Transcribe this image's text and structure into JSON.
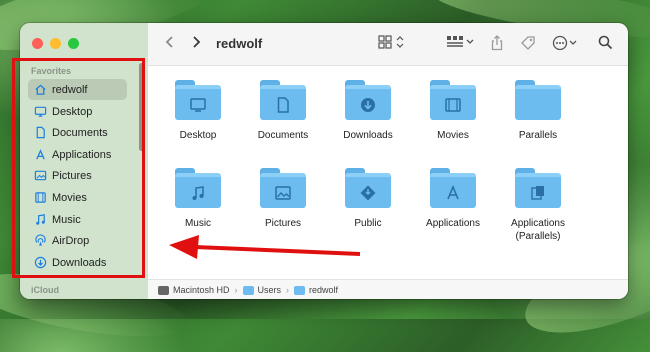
{
  "window": {
    "title": "redwolf"
  },
  "sidebar": {
    "section_label": "Favorites",
    "items": [
      {
        "label": "redwolf",
        "icon": "house-icon",
        "selected": true
      },
      {
        "label": "Desktop",
        "icon": "desktop-icon"
      },
      {
        "label": "Documents",
        "icon": "document-icon"
      },
      {
        "label": "Applications",
        "icon": "applications-icon"
      },
      {
        "label": "Pictures",
        "icon": "pictures-icon"
      },
      {
        "label": "Movies",
        "icon": "film-icon"
      },
      {
        "label": "Music",
        "icon": "music-note-icon"
      },
      {
        "label": "AirDrop",
        "icon": "airdrop-icon"
      },
      {
        "label": "Downloads",
        "icon": "download-icon"
      }
    ],
    "bottom_section_label": "iCloud"
  },
  "toolbar": {
    "back_icon": "chevron-left-icon",
    "forward_icon": "chevron-right-icon",
    "view_icon": "grid-view-icon",
    "group_icon": "group-icon",
    "share_icon": "share-icon",
    "tag_icon": "tag-icon",
    "more_icon": "ellipsis-circle-icon",
    "search_icon": "search-icon"
  },
  "folders": [
    {
      "label": "Desktop",
      "glyph": "desktop-glyph"
    },
    {
      "label": "Documents",
      "glyph": "document-glyph"
    },
    {
      "label": "Downloads",
      "glyph": "download-glyph"
    },
    {
      "label": "Movies",
      "glyph": "film-glyph"
    },
    {
      "label": "Parallels",
      "glyph": "none"
    },
    {
      "label": "Music",
      "glyph": "music-glyph"
    },
    {
      "label": "Pictures",
      "glyph": "picture-glyph"
    },
    {
      "label": "Public",
      "glyph": "public-glyph"
    },
    {
      "label": "Applications",
      "glyph": "applications-glyph"
    },
    {
      "label": "Applications (Parallels)",
      "glyph": "parallels-apps-glyph"
    }
  ],
  "pathbar": {
    "segments": [
      "Macintosh HD",
      "Users",
      "redwolf"
    ]
  },
  "colors": {
    "accent_red": "#e01010",
    "folder_blue": "#6cbcf0"
  }
}
